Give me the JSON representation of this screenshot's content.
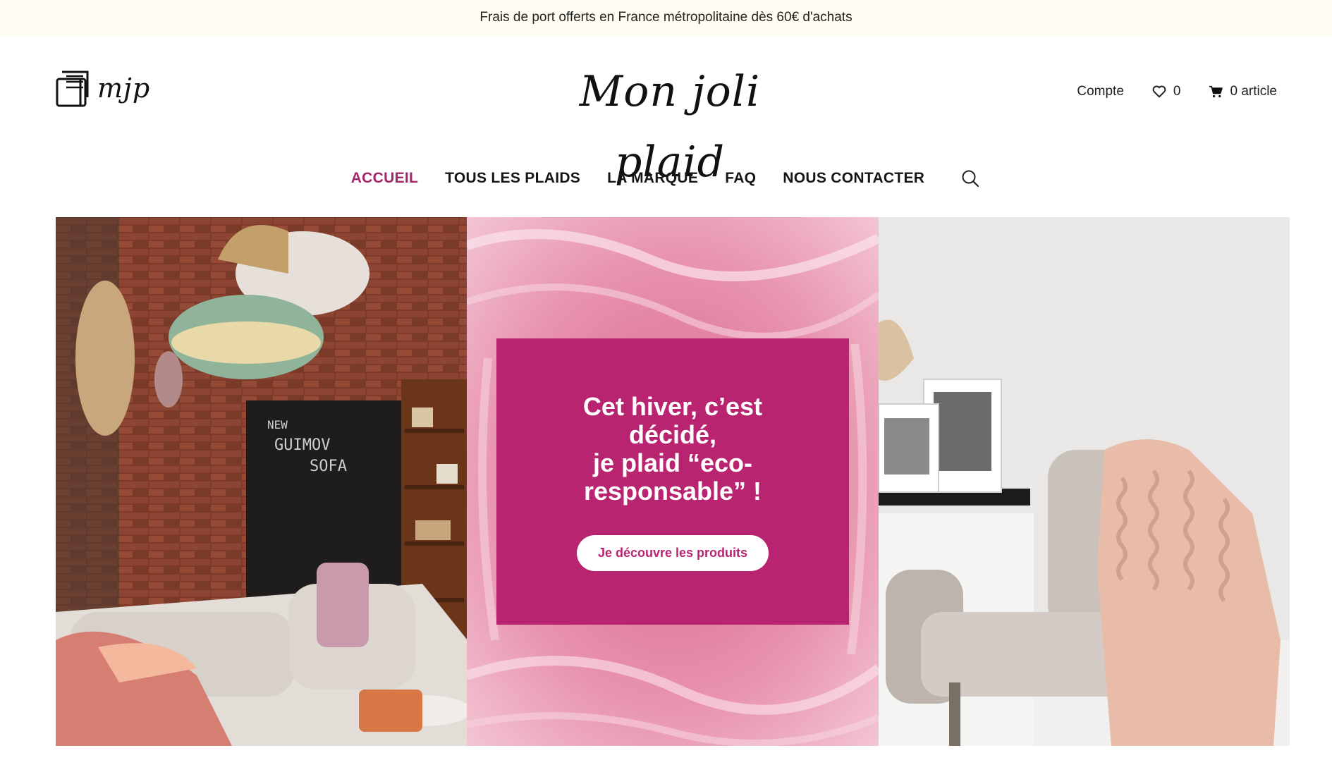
{
  "announcement": "Frais de port offerts en France métropolitaine dès 60€ d'achats",
  "header": {
    "small_logo_text": "mjp",
    "brand_name": "Mon joli plaid",
    "account_label": "Compte",
    "wishlist_count": "0",
    "cart_label": "0 article"
  },
  "nav": {
    "items": [
      {
        "label": "ACCUEIL",
        "active": true
      },
      {
        "label": "TOUS LES PLAIDS",
        "active": false
      },
      {
        "label": "LA MARQUE",
        "active": false
      },
      {
        "label": "FAQ",
        "active": false
      },
      {
        "label": "NOUS CONTACTER",
        "active": false
      }
    ]
  },
  "hero": {
    "title_line1": "Cet hiver, c’est décidé,",
    "title_line2": "je plaid “eco-responsable” !",
    "cta_label": "Je découvre les produits"
  },
  "colors": {
    "accent": "#a3266b",
    "promo_bg": "#b8246f",
    "topbar_bg": "#fffdf2"
  }
}
